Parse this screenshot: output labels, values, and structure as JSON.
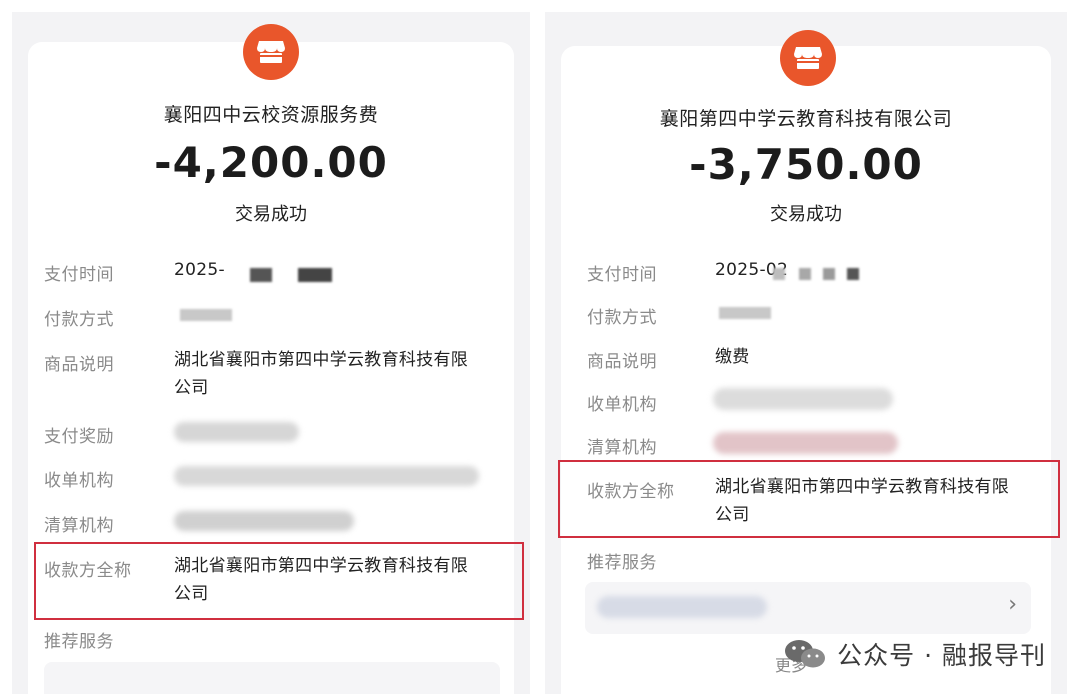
{
  "left": {
    "merchant": "襄阳四中云校资源服务费",
    "amount": "-4,200.00",
    "status": "交易成功",
    "rows": [
      {
        "label": "支付时间",
        "value": "2025-"
      },
      {
        "label": "付款方式",
        "value": ""
      },
      {
        "label": "商品说明",
        "value": "湖北省襄阳市第四中学云教育科技有限",
        "value2": "公司"
      },
      {
        "label": "支付奖励",
        "value": ""
      },
      {
        "label": "收单机构",
        "value": ""
      },
      {
        "label": "清算机构",
        "value": ""
      },
      {
        "label": "收款方全称",
        "value": "湖北省襄阳市第四中学云教育科技有限",
        "value2": "公司"
      },
      {
        "label": "推荐服务",
        "value": ""
      }
    ]
  },
  "right": {
    "merchant": "襄阳第四中学云教育科技有限公司",
    "amount": "-3,750.00",
    "status": "交易成功",
    "rows": [
      {
        "label": "支付时间",
        "value": "2025-02"
      },
      {
        "label": "付款方式",
        "value": ""
      },
      {
        "label": "商品说明",
        "value": "缴费"
      },
      {
        "label": "收单机构",
        "value": ""
      },
      {
        "label": "清算机构",
        "value": ""
      },
      {
        "label": "收款方全称",
        "value": "湖北省襄阳市第四中学云教育科技有限",
        "value2": "公司"
      },
      {
        "label": "推荐服务",
        "value": ""
      }
    ],
    "more_label": "更多"
  },
  "watermark": {
    "text": "公众号 · 融报导刊"
  },
  "colors": {
    "accent": "#e9562b",
    "highlight": "#d02f3f"
  },
  "icons": {
    "merchant": "shop-icon",
    "chevron": "chevron-right-icon",
    "watermark": "wechat-icon"
  }
}
